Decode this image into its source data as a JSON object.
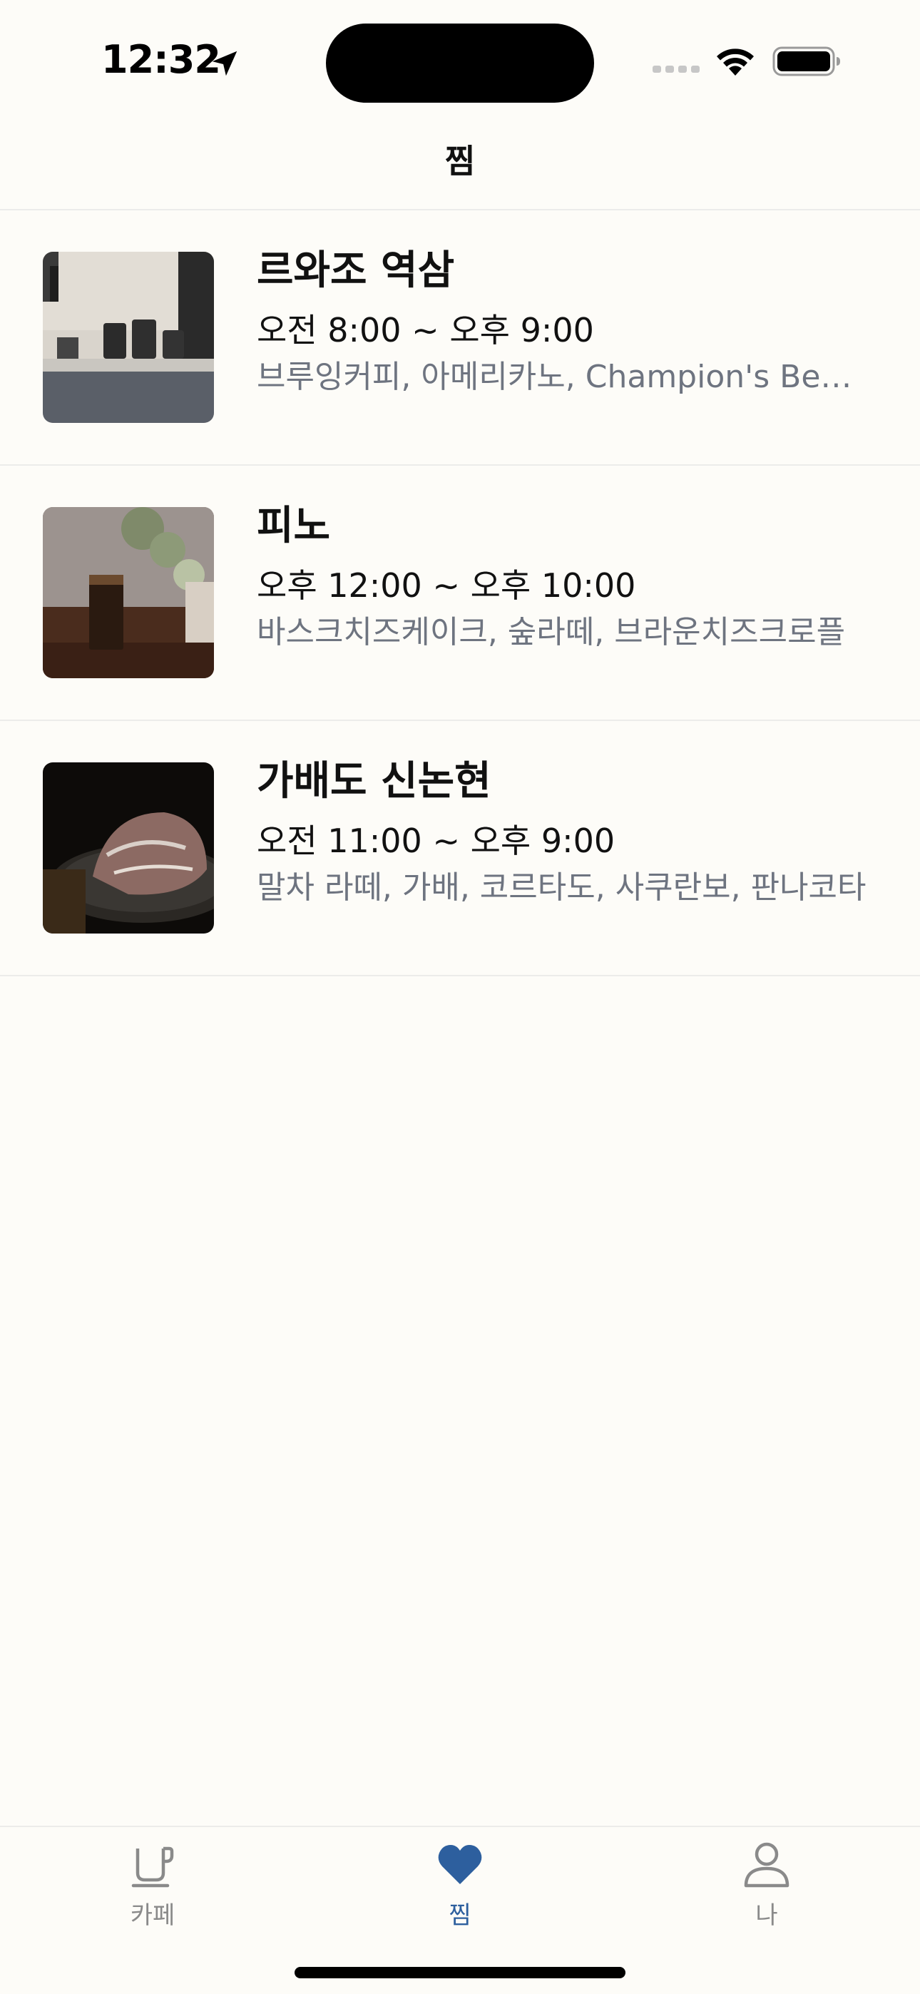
{
  "status_bar": {
    "time": "12:32",
    "icons": [
      "location-arrow-icon",
      "cellular-signal-icon",
      "wifi-icon",
      "battery-icon"
    ]
  },
  "header": {
    "title": "찜"
  },
  "favorites": [
    {
      "name": "르와조 역삼",
      "hours": "오전 8:00 ~ 오후 9:00",
      "menu": "브루잉커피, 아메리카노, Champion's Beverage",
      "image": "cafe-counter-with-coffee-servers-photo"
    },
    {
      "name": "피노",
      "hours": "오후 12:00 ~ 오후 10:00",
      "menu": "바스크치즈케이크, 숲라떼, 브라운치즈크로플",
      "image": "iced-coffee-glass-on-table-photo"
    },
    {
      "name": "가배도 신논현",
      "hours": "오전 11:00 ~ 오후 9:00",
      "menu": "말차 라떼, 가배, 코르타도, 사쿠란보, 판나코타",
      "image": "dessert-plate-dark-photo"
    }
  ],
  "tab_bar": {
    "tabs": [
      {
        "label": "카페",
        "icon": "coffee-cup-icon",
        "active": false
      },
      {
        "label": "찜",
        "icon": "heart-icon",
        "active": true
      },
      {
        "label": "나",
        "icon": "person-icon",
        "active": false
      }
    ]
  },
  "colors": {
    "background": "#fdfcf8",
    "accent": "#2d5f9e",
    "secondary_text": "#6e7480",
    "inactive_tab": "#8a8a8a",
    "divider": "#ececea"
  }
}
